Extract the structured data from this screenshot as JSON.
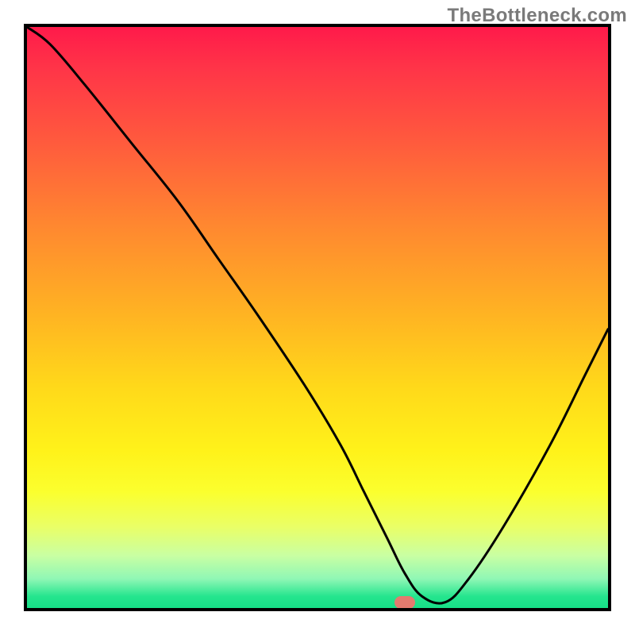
{
  "watermark": "TheBottleneck.com",
  "chart_data": {
    "type": "line",
    "title": "",
    "xlabel": "",
    "ylabel": "",
    "xlim": [
      0,
      100
    ],
    "ylim": [
      0,
      100
    ],
    "grid": false,
    "legend": false,
    "series": [
      {
        "name": "bottleneck-curve",
        "x": [
          0,
          4,
          10,
          18,
          26,
          33,
          40,
          48,
          54,
          58,
          62,
          65,
          68,
          72,
          76,
          82,
          90,
          96,
          100
        ],
        "values": [
          100,
          97,
          90,
          80,
          70,
          60,
          50,
          38,
          28,
          20,
          12,
          6,
          2,
          1,
          5,
          14,
          28,
          40,
          48
        ]
      }
    ],
    "marker": {
      "x": 65,
      "y": 1,
      "color": "#e37b6f"
    },
    "background_gradient": {
      "stops": [
        {
          "pct": 0.0,
          "color": "#ff1a4a"
        },
        {
          "pct": 0.07,
          "color": "#ff3448"
        },
        {
          "pct": 0.2,
          "color": "#ff5b3d"
        },
        {
          "pct": 0.35,
          "color": "#ff8a2f"
        },
        {
          "pct": 0.5,
          "color": "#ffb522"
        },
        {
          "pct": 0.62,
          "color": "#ffd91a"
        },
        {
          "pct": 0.73,
          "color": "#fff21a"
        },
        {
          "pct": 0.8,
          "color": "#fbff2e"
        },
        {
          "pct": 0.86,
          "color": "#eaff66"
        },
        {
          "pct": 0.91,
          "color": "#c9ffa3"
        },
        {
          "pct": 0.95,
          "color": "#8ff7b5"
        },
        {
          "pct": 0.98,
          "color": "#25e58e"
        },
        {
          "pct": 1.0,
          "color": "#17df87"
        }
      ]
    }
  }
}
